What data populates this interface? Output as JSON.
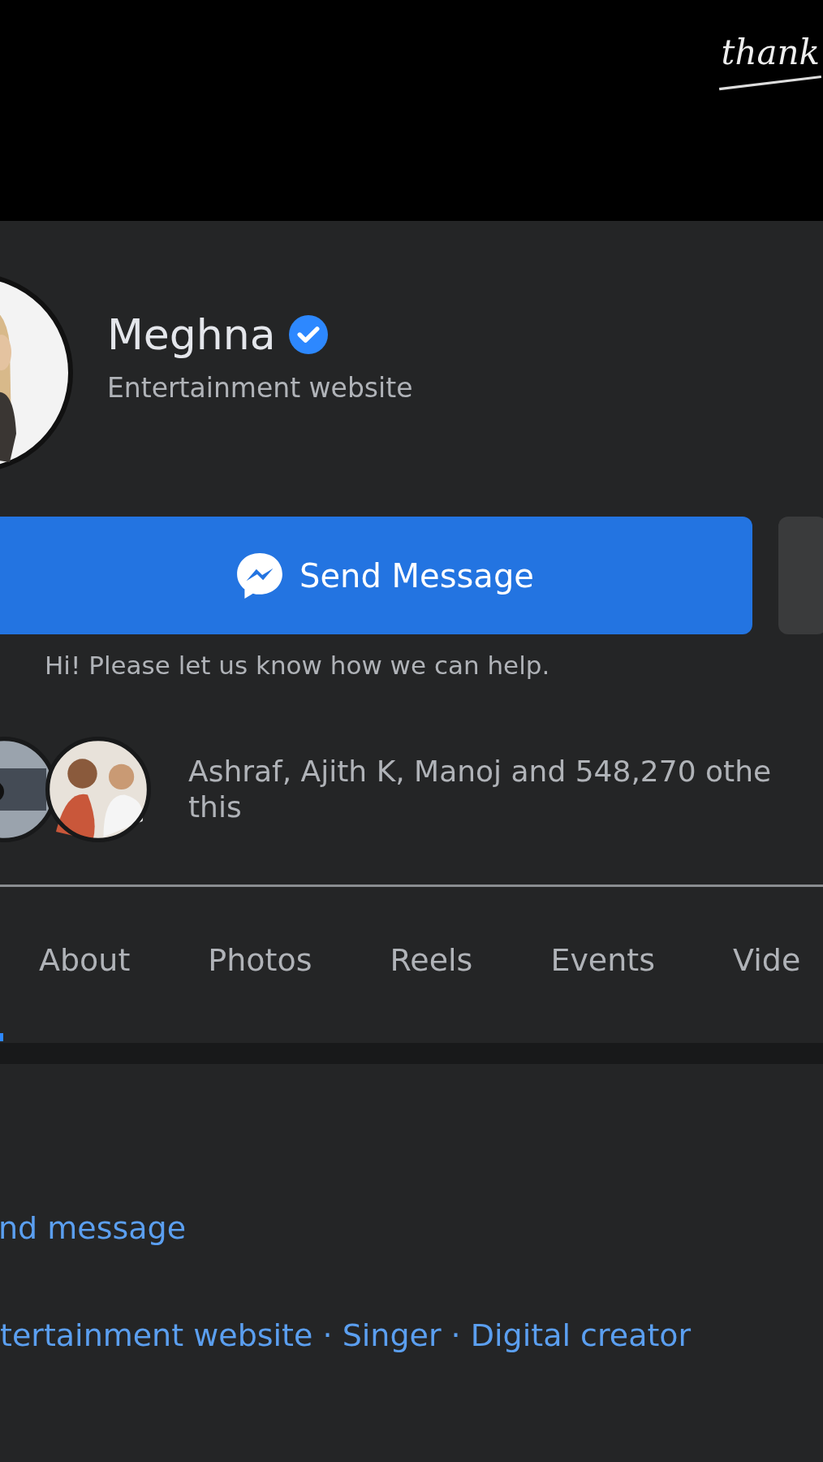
{
  "overlay_text": "thank",
  "profile": {
    "name": "Meghna",
    "verified": true,
    "category": "Entertainment website"
  },
  "message_button": {
    "label": "Send Message"
  },
  "greeting": "Hi! Please let us know how we can help.",
  "likes": {
    "text": "Ashraf, Ajith K, Manoj and 548,270 othe",
    "text_2": "this"
  },
  "tabs": [
    {
      "label": "About",
      "selected": false
    },
    {
      "label": "Photos",
      "selected": false
    },
    {
      "label": "Reels",
      "selected": false
    },
    {
      "label": "Events",
      "selected": false
    },
    {
      "label": "Vide",
      "selected": false
    }
  ],
  "about": {
    "message_link": "nd message",
    "categories": "tertainment website · Singer · Digital creator"
  }
}
